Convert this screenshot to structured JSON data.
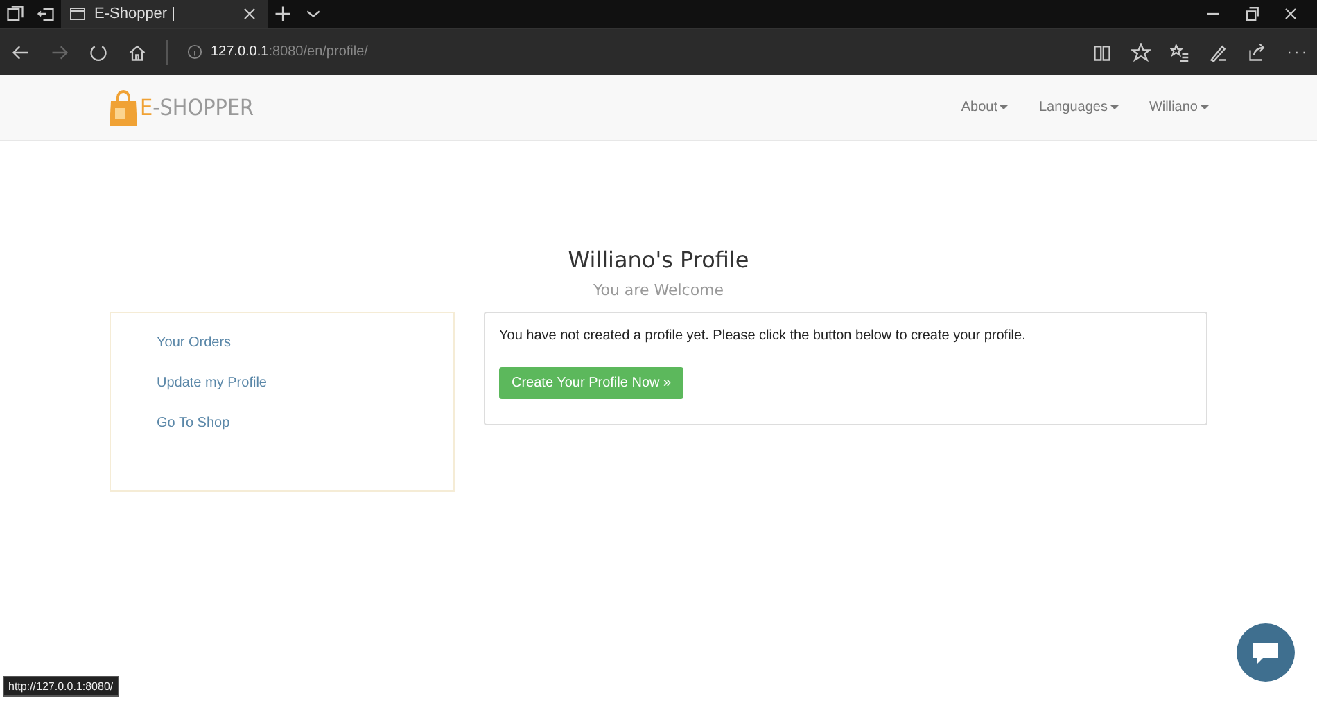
{
  "browser": {
    "tab_title": "E-Shopper |",
    "url_host": "127.0.0.1",
    "url_path": ":8080/en/profile/",
    "status_url": "http://127.0.0.1:8080/"
  },
  "navbar": {
    "logo_accent": "E",
    "logo_rest": "-SHOPPER",
    "menu": [
      {
        "label": "About"
      },
      {
        "label": "Languages"
      },
      {
        "label": "Williano"
      }
    ]
  },
  "profile": {
    "title": "Williano's Profile",
    "subtitle": "You are Welcome"
  },
  "sidebar": {
    "items": [
      {
        "label": "Your Orders"
      },
      {
        "label": "Update my Profile"
      },
      {
        "label": "Go To Shop"
      }
    ]
  },
  "panel": {
    "message": "You have not created a profile yet. Please click the button below to create your profile.",
    "button": "Create Your Profile Now »"
  }
}
